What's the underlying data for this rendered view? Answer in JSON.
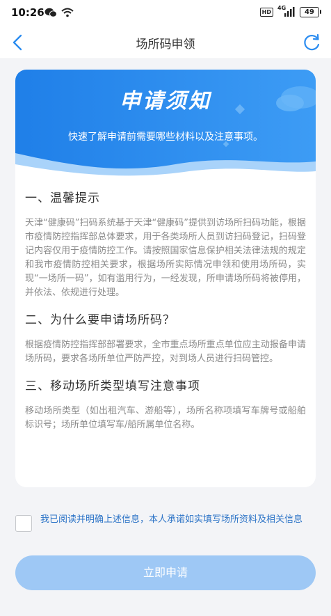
{
  "status_bar": {
    "time": "10:26",
    "hd_label": "HD",
    "network_label": "4G",
    "battery": "49"
  },
  "nav": {
    "title": "场所码申领"
  },
  "banner": {
    "title": "申请须知",
    "subtitle": "快速了解申请前需要哪些材料以及注意事项。"
  },
  "sections": [
    {
      "title": "一、温馨提示",
      "body": "天津“健康码”扫码系统基于天津“健康码”提供到访场所扫码功能，根据市疫情防控指挥部总体要求，用于各类场所人员到访扫码登记，扫码登记内容仅用于疫情防控工作。请按照国家信息保护相关法律法规的规定和我市疫情防控相关要求，根据场所实际情况申领和使用场所码，实现“一场所一码”，如有滥用行为，一经发现，所申请场所码将被停用，并依法、依规进行处理。"
    },
    {
      "title": "二、为什么要申请场所码？",
      "body": "根据疫情防控指挥部部署要求，全市重点场所重点单位应主动报备申请场所码，要求各场所单位严防严控，对到场人员进行扫码管控。"
    },
    {
      "title": "三、移动场所类型填写注意事项",
      "body": "移动场所类型（如出租汽车、游船等），场所名称项填写车牌号或船舶标识号；场所单位填写车/船所属单位名称。"
    }
  ],
  "agreement": {
    "text": "我已阅读并明确上述信息，本人承诺如实填写场所资料及相关信息",
    "checked": false
  },
  "submit": {
    "label": "立即申请"
  },
  "colors": {
    "accent": "#2b8cf0",
    "link": "#2d74c7",
    "button_disabled": "#9ec8f5"
  }
}
